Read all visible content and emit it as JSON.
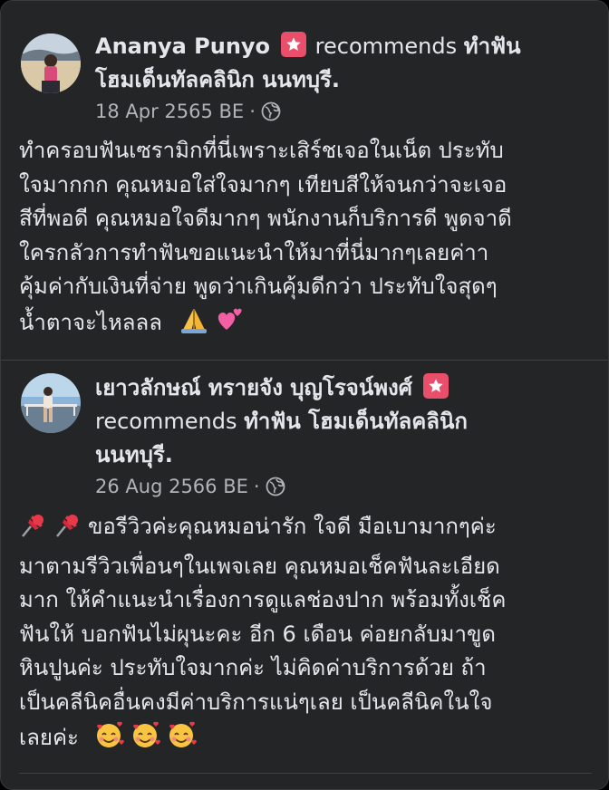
{
  "reviews": [
    {
      "author": "Ananya Punyo",
      "action": "recommends",
      "page_name_line1": "ทำฟัน",
      "page_name_line2": "โฮมเด็นทัลคลินิก นนทบุรี.",
      "date": "18 Apr 2565 BE",
      "separator": "·",
      "audience_icon": "globe-icon",
      "body_lines": [
        "ทำครอบฟันเซรามิกที่นี่เพราะเสิร์ชเจอในเน็ต ประทับ",
        "ใจมากกก คุณหมอใส่ใจมากๆ เทียบสีให้จนกว่าจะเจอ",
        "สีที่พอดี คุณหมอใจดีมากๆ พนักงานก็บริการดี พูดจาดี",
        "ใครกลัวการทำฟันขอแนะนำให้มาที่นี่มากๆเลยค่าา",
        "คุ้มค่ากับเงินที่จ่าย พูดว่าเกินคุ้มดีกว่า ประทับใจสุดๆ",
        "น้ำตาจะไหลลล"
      ],
      "trailing_emojis": [
        "folded-hands-emoji",
        "two-hearts-emoji"
      ]
    },
    {
      "author": "เยาวลักษณ์ ทรายจัง บุญโรจน์พงศ์",
      "action": "recommends",
      "page_name_line1": "ทำฟัน โฮมเด็นทัลคลินิก",
      "page_name_line2": "นนทบุรี.",
      "date": "26 Aug 2566 BE",
      "separator": "·",
      "audience_icon": "globe-icon",
      "leading_emojis": [
        "pushpin-emoji",
        "pushpin-emoji"
      ],
      "body_lines": [
        "ขอรีวิวค่ะคุณหมอน่ารัก ใจดี มือเบามากๆค่ะ",
        "มาตามรีวิวเพื่อนๆในเพจเลย คุณหมอเช็คฟันละเอียด",
        "มาก ให้คำแนะนำเรื่องการดูแลช่องปาก  พร้อมทั้งเช็ค",
        "ฟันให้ บอกฟันไม่ผุนะคะ อีก 6 เดือน ค่อยกลับมาขูด",
        "หินปูนค่ะ ประทับใจมากค่ะ ไม่คิดค่าบริการด้วย ถ้า",
        "เป็นคลีนิคอื่นคงมีค่าบริการแน่ๆเลย เป็นคลีนิคในใจ",
        "เลยค่ะ"
      ],
      "trailing_emojis": [
        "smiling-face-with-hearts-emoji",
        "smiling-face-with-hearts-emoji",
        "smiling-face-with-hearts-emoji"
      ]
    }
  ],
  "colors": {
    "card_background": "#242526",
    "primary_text": "#e4e6eb",
    "secondary_text": "#b0b3b8",
    "badge": "#e94e6a",
    "divider": "#3e4042"
  }
}
